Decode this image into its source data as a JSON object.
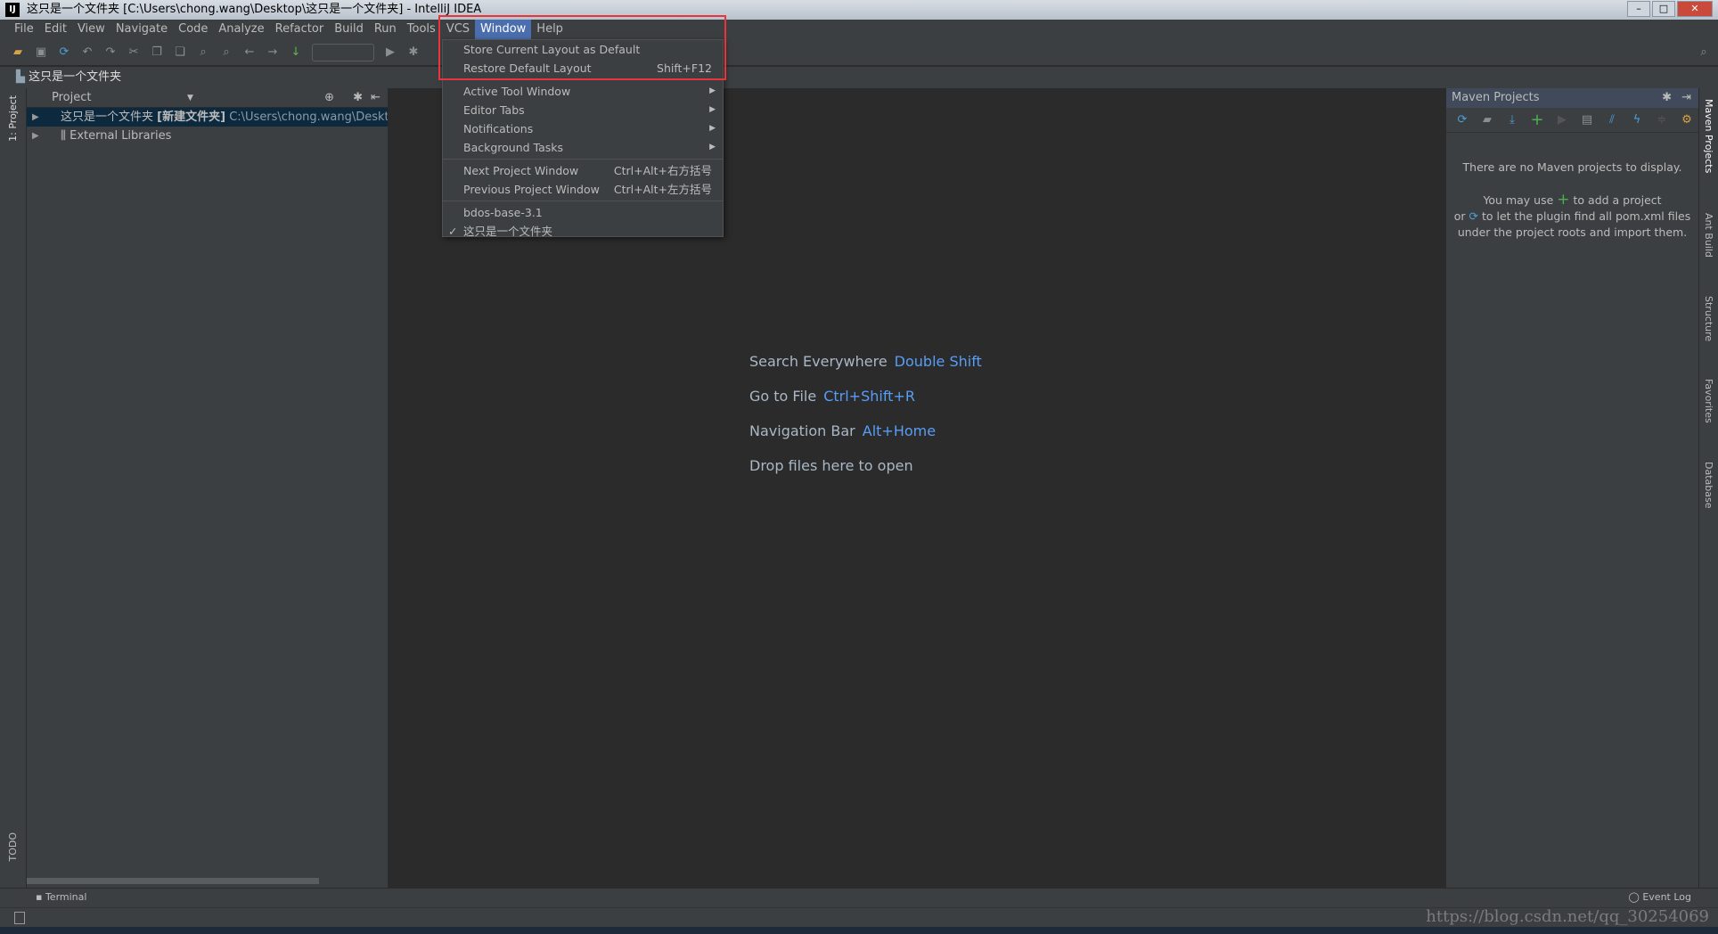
{
  "window": {
    "title": "这只是一个文件夹 [C:\\Users\\chong.wang\\Desktop\\这只是一个文件夹] - IntelliJ IDEA",
    "logo": "IJ"
  },
  "menubar": [
    "File",
    "Edit",
    "View",
    "Navigate",
    "Code",
    "Analyze",
    "Refactor",
    "Build",
    "Run",
    "Tools",
    "VCS",
    "Window",
    "Help"
  ],
  "active_menu": "Window",
  "breadcrumb": "这只是一个文件夹",
  "project_panel": {
    "title": "Project",
    "tree": [
      {
        "name": "这只是一个文件夹",
        "tag": "[新建文件夹]",
        "path": "C:\\Users\\chong.wang\\Desktop\\这"
      },
      {
        "name": "External Libraries"
      }
    ]
  },
  "left_tabs": {
    "project": "1: Project",
    "todo": "TODO"
  },
  "window_menu": {
    "items": [
      {
        "label": "Store Current Layout as Default",
        "shortcut": ""
      },
      {
        "label": "Restore Default Layout",
        "shortcut": "Shift+F12"
      },
      {
        "label": "Active Tool Window",
        "submenu": true
      },
      {
        "label": "Editor Tabs",
        "submenu": true
      },
      {
        "label": "Notifications",
        "submenu": true
      },
      {
        "label": "Background Tasks",
        "submenu": true
      },
      {
        "label": "Next Project Window",
        "shortcut": "Ctrl+Alt+右方括号"
      },
      {
        "label": "Previous Project Window",
        "shortcut": "Ctrl+Alt+左方括号"
      },
      {
        "label": "bdos-base-3.1"
      },
      {
        "label": "这只是一个文件夹",
        "checked": true
      }
    ]
  },
  "editor_hints": [
    {
      "label": "Search Everywhere",
      "key": "Double Shift"
    },
    {
      "label": "Go to File",
      "key": "Ctrl+Shift+R"
    },
    {
      "label": "Navigation Bar",
      "key": "Alt+Home"
    },
    {
      "label": "Drop files here to open",
      "key": ""
    }
  ],
  "maven": {
    "title": "Maven Projects",
    "empty": "There are no Maven projects to display.",
    "hint1a": "You may use",
    "hint1b": "to add a project",
    "hint2a": "or",
    "hint2b": "to let the plugin find all pom.xml files",
    "hint3": "under the project roots and import them."
  },
  "right_tabs": [
    "Maven Projects",
    "Ant Build",
    "Structure",
    "Favorites",
    "Database"
  ],
  "bottom": {
    "terminal": "Terminal",
    "event_log": "Event Log"
  },
  "watermark": "https://blog.csdn.net/qq_30254069",
  "colors": {
    "accent": "#4b6eaf",
    "link": "#589df6",
    "highlight_box": "#e8343a"
  }
}
